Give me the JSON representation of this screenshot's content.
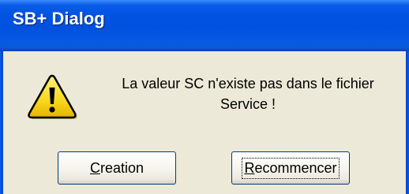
{
  "window": {
    "title": "SB+ Dialog"
  },
  "dialog": {
    "icon": "warning-icon",
    "message_line1": "La valeur SC n'existe pas dans le fichier",
    "message_line2": "Service !"
  },
  "buttons": {
    "creation_label": "Creation",
    "recommencer_label": "Recommencer"
  },
  "colors": {
    "titlebar": "#0053e1",
    "client": "#ece9d8",
    "warning_yellow": "#f8d81c"
  }
}
